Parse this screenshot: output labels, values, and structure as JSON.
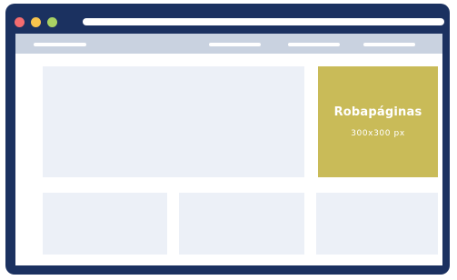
{
  "window": {
    "controls": [
      {
        "name": "close",
        "color": "#f46c6f"
      },
      {
        "name": "minimize",
        "color": "#f8c44d"
      },
      {
        "name": "maximize",
        "color": "#a9d263"
      }
    ]
  },
  "colors": {
    "frame": "#1b3160",
    "navbar": "#c9d2e0",
    "placeholder": "#ecf0f7",
    "ad_background": "#c9bb58"
  },
  "ad": {
    "title": "Robapáginas",
    "size": "300x300 px"
  }
}
